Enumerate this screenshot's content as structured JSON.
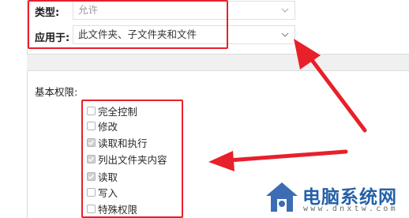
{
  "header": {
    "type_label": "类型:",
    "type_value": "允许",
    "applies_label": "应用于:",
    "applies_value": "此文件夹、子文件夹和文件"
  },
  "permissions": {
    "title": "基本权限:",
    "items": [
      {
        "label": "完全控制",
        "checked": false
      },
      {
        "label": "修改",
        "checked": false
      },
      {
        "label": "读取和执行",
        "checked": true
      },
      {
        "label": "列出文件夹内容",
        "checked": true
      },
      {
        "label": "读取",
        "checked": true
      },
      {
        "label": "写入",
        "checked": false
      },
      {
        "label": "特殊权限",
        "checked": false
      }
    ]
  },
  "watermark": {
    "name": "电脑系统网",
    "url": "www.dnxtw.com"
  },
  "colors": {
    "annotation_red": "#e8202a",
    "logo_blue": "#2461a8",
    "logo_house": "#3c6db4"
  }
}
